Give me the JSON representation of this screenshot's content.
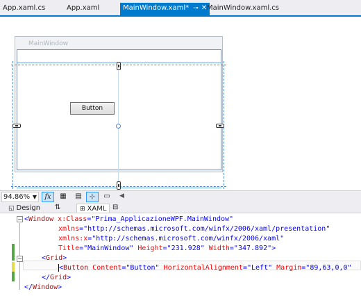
{
  "tabs": [
    {
      "label": "App.xaml.cs",
      "active": false
    },
    {
      "label": "App.xaml",
      "active": false
    },
    {
      "label": "MainWindow.xaml*",
      "active": true,
      "pin_icon": "pin-icon",
      "close_icon": "close-icon"
    },
    {
      "label": "MainWindow.xaml.cs",
      "active": false
    }
  ],
  "designer": {
    "window_title": "MainWindow",
    "button_label": "Button"
  },
  "toolbar": {
    "zoom": "94.86%",
    "fx_label": "fx",
    "icons": [
      "grid-icon",
      "snap-grid-icon",
      "snap-lines-icon",
      "annotation-icon"
    ]
  },
  "split": {
    "design_label": "Design",
    "swap_icon": "swap-panes-icon",
    "xaml_label": "XAML",
    "collapse_icon": "collapse-pane-icon"
  },
  "code": {
    "l1": {
      "bracket": "<",
      "tag": "Window",
      "attr": " x:Class",
      "eq": "=",
      "val": "\"Prima_ApplicazioneWPF.MainWindow\""
    },
    "l2": {
      "attr": "xmlns",
      "eq": "=",
      "val": "\"http://schemas.microsoft.com/winfx/2006/xaml/presentation\""
    },
    "l3": {
      "attr": "xmlns:x",
      "eq": "=",
      "val": "\"http://schemas.microsoft.com/winfx/2006/xaml\""
    },
    "l4": {
      "a1": "Title",
      "v1": "\"MainWindow\"",
      "a2": " Height",
      "v2": "\"231.928\"",
      "a3": " Width",
      "v3": "\"347.892\"",
      "end": ">"
    },
    "l5": {
      "open": "<",
      "tag": "Grid",
      "close": ">"
    },
    "l6": {
      "open": "<",
      "tag": "Button",
      "a1": " Content",
      "v1": "\"Button\"",
      "a2": " HorizontalAlignment",
      "v2": "\"Left\"",
      "a3": " Margin",
      "v3": "\"89,63,0,0\""
    },
    "l7": {
      "open": "</",
      "tag": "Grid",
      "close": ">"
    },
    "l8": {
      "open": "</",
      "tag": "Window",
      "close": ">"
    }
  },
  "colors": {
    "accent": "#007acc",
    "xaml_tag": "#a31515",
    "xaml_attr": "#ff0000",
    "xaml_value": "#0000ff",
    "change_saved": "#57a64a",
    "change_unsaved": "#e5d94d"
  }
}
